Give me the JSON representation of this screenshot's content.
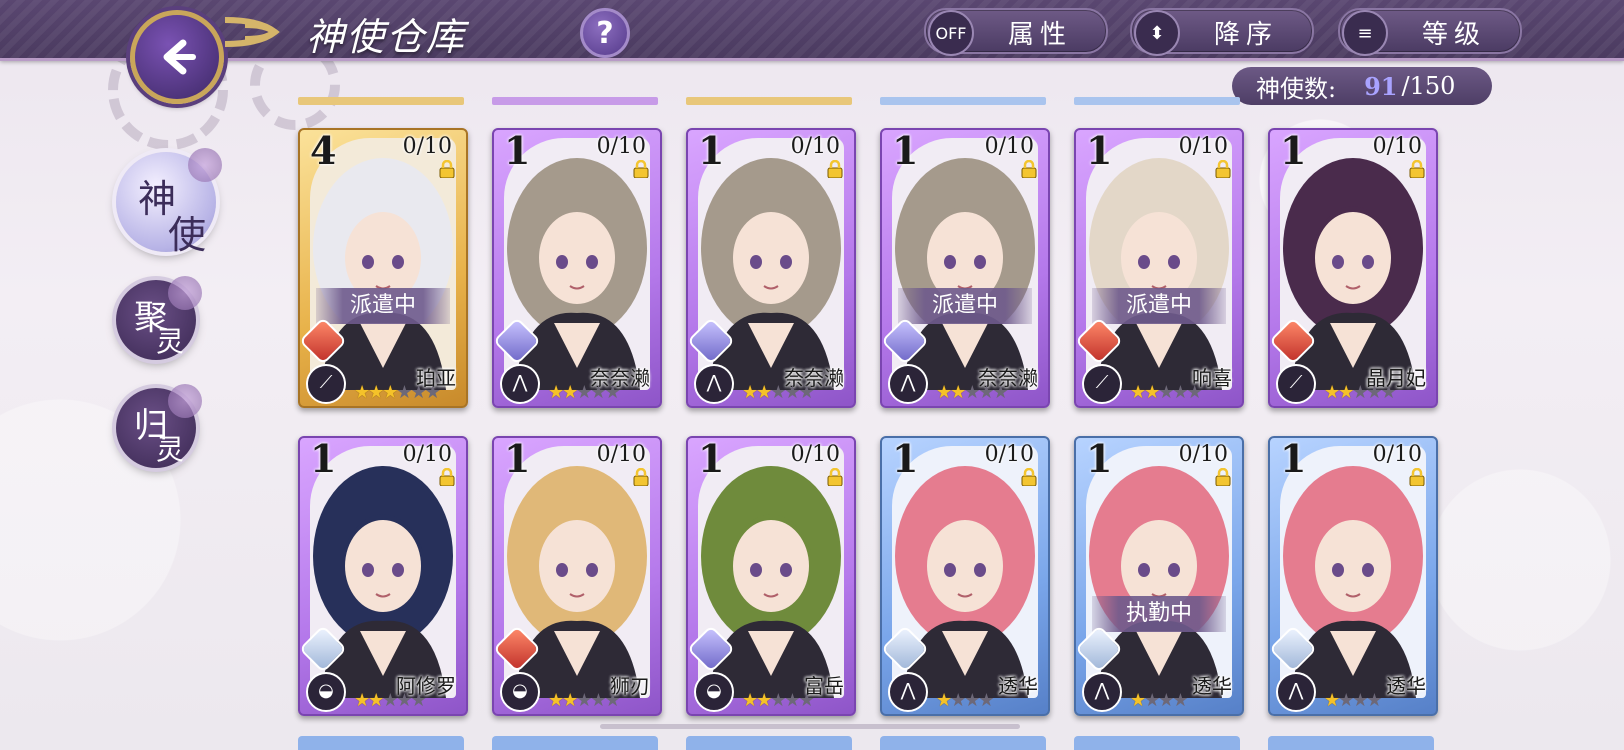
{
  "header": {
    "title": "神使仓库",
    "help_label": "?",
    "attr_toggle_label": "OFF",
    "attr_label": "属性",
    "order_label": "降序",
    "sort_label": "等级"
  },
  "count": {
    "label": "神使数:",
    "current": "91",
    "max": "/150"
  },
  "sidebar": {
    "items": [
      {
        "c1": "神",
        "c2": "使"
      },
      {
        "c1": "聚",
        "c2": "灵"
      },
      {
        "c1": "归",
        "c2": "灵"
      }
    ]
  },
  "cards": [
    {
      "level": "4",
      "count": "0/10",
      "name": "珀亚",
      "status": "派遣中",
      "rarity": "gold",
      "element": "fire",
      "weapon": "sword",
      "stars": 3,
      "max_stars": 6,
      "hair": "#e9e9ef"
    },
    {
      "level": "1",
      "count": "0/10",
      "name": "奈奈濑",
      "status": "",
      "rarity": "purple",
      "element": "wind",
      "weapon": "claw",
      "stars": 2,
      "max_stars": 5,
      "hair": "#a59a8c"
    },
    {
      "level": "1",
      "count": "0/10",
      "name": "奈奈濑",
      "status": "",
      "rarity": "purple",
      "element": "wind",
      "weapon": "claw",
      "stars": 2,
      "max_stars": 5,
      "hair": "#a59a8c"
    },
    {
      "level": "1",
      "count": "0/10",
      "name": "奈奈濑",
      "status": "派遣中",
      "rarity": "purple",
      "element": "wind",
      "weapon": "claw",
      "stars": 2,
      "max_stars": 5,
      "hair": "#a59a8c"
    },
    {
      "level": "1",
      "count": "0/10",
      "name": "响喜",
      "status": "派遣中",
      "rarity": "purple",
      "element": "fire",
      "weapon": "sword",
      "stars": 2,
      "max_stars": 5,
      "hair": "#e3d7c8"
    },
    {
      "level": "1",
      "count": "0/10",
      "name": "晶月妃",
      "status": "",
      "rarity": "purple",
      "element": "fire",
      "weapon": "sword",
      "stars": 2,
      "max_stars": 5,
      "hair": "#4a2b4c"
    },
    {
      "level": "1",
      "count": "0/10",
      "name": "阿修罗",
      "status": "",
      "rarity": "purple",
      "element": "ice",
      "weapon": "helm",
      "stars": 2,
      "max_stars": 5,
      "hair": "#27305a"
    },
    {
      "level": "1",
      "count": "0/10",
      "name": "狮刃",
      "status": "",
      "rarity": "purple",
      "element": "fire",
      "weapon": "helm",
      "stars": 2,
      "max_stars": 5,
      "hair": "#e0b878"
    },
    {
      "level": "1",
      "count": "0/10",
      "name": "富岳",
      "status": "",
      "rarity": "purple",
      "element": "wind",
      "weapon": "helm",
      "stars": 2,
      "max_stars": 5,
      "hair": "#6f8b3c"
    },
    {
      "level": "1",
      "count": "0/10",
      "name": "透华",
      "status": "",
      "rarity": "blue",
      "element": "ice",
      "weapon": "claw",
      "stars": 1,
      "max_stars": 4,
      "hair": "#e57c8f"
    },
    {
      "level": "1",
      "count": "0/10",
      "name": "透华",
      "status": "执勤中",
      "rarity": "blue",
      "element": "ice",
      "weapon": "claw",
      "stars": 1,
      "max_stars": 4,
      "hair": "#e57c8f"
    },
    {
      "level": "1",
      "count": "0/10",
      "name": "透华",
      "status": "",
      "rarity": "blue",
      "element": "ice",
      "weapon": "claw",
      "stars": 1,
      "max_stars": 4,
      "hair": "#e57c8f"
    }
  ]
}
